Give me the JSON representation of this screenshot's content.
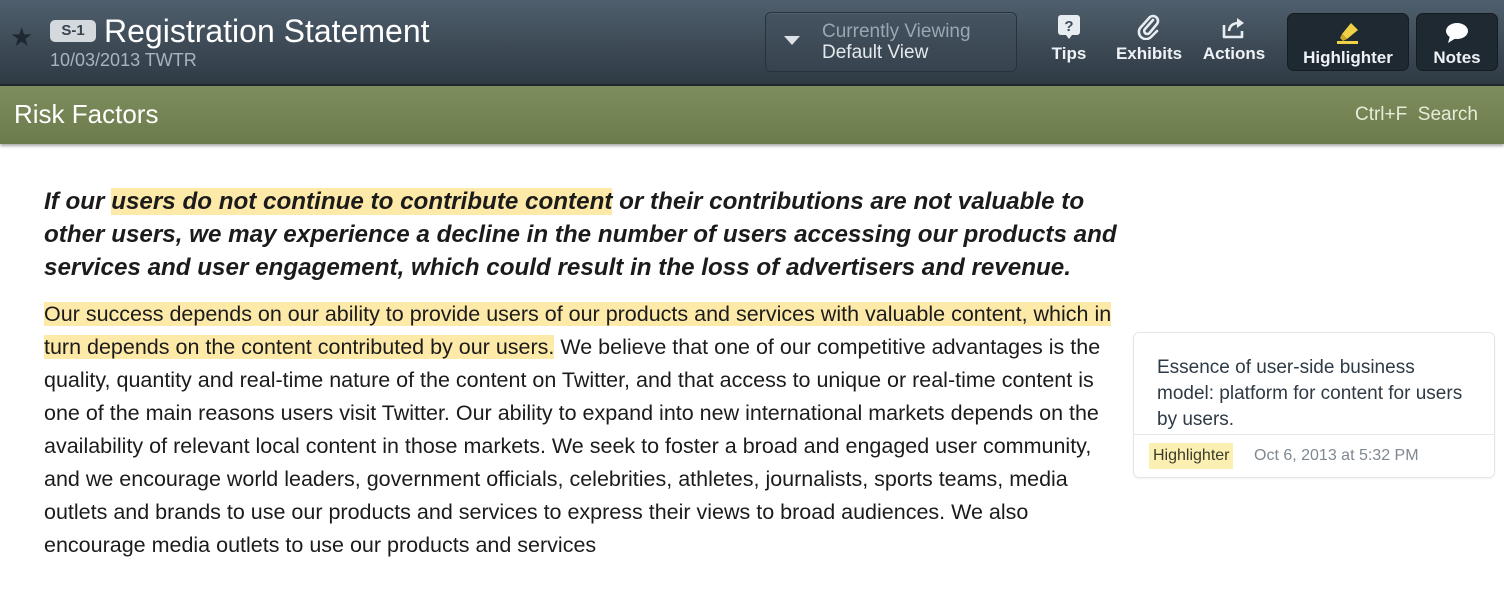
{
  "header": {
    "badge": "S-1",
    "title": "Registration Statement",
    "subtitle": "10/03/2013 TWTR",
    "viewing": {
      "label": "Currently Viewing",
      "value": "Default View"
    },
    "tools": [
      {
        "label": "Tips",
        "icon": "question-icon"
      },
      {
        "label": "Exhibits",
        "icon": "paperclip-icon"
      },
      {
        "label": "Actions",
        "icon": "share-icon"
      },
      {
        "label": "Highlighter",
        "icon": "highlighter-icon"
      },
      {
        "label": "Notes",
        "icon": "speech-bubble-icon"
      }
    ]
  },
  "section": {
    "title": "Risk Factors",
    "search": "Ctrl+F  Search"
  },
  "document": {
    "heading_pre": "If our ",
    "heading_hl": "users do not continue to contribute content",
    "heading_post": " or their contributions are not valuable to other users, we may experience a decline in the number of users accessing our products and services and user engagement, which could result in the loss of advertisers and revenue.",
    "para_hl": "Our success depends on our ability to provide users of our products and services with valuable content, which in turn depends on the content contributed by our users.",
    "para_rest": " We believe that one of our competitive advantages is the quality, quantity and real-time nature of the content on Twitter, and that access to unique or real-time content is one of the main reasons users visit Twitter. Our ability to expand into new international markets depends on the availability of relevant local content in those markets. We seek to foster a broad and engaged user community, and we encourage world leaders, government officials, celebrities, athletes, journalists, sports teams, media outlets and brands to use our products and services to express their views to broad audiences. We also encourage media outlets to use our products and services"
  },
  "note": {
    "text": "Essence of user-side business model: platform for content for users by users.",
    "tag": "Highlighter",
    "date": "Oct 6, 2013 at 5:32 PM"
  },
  "colors": {
    "header_bg": "#3d4a56",
    "section_bg": "#6b7b4c",
    "highlight": "#fde9a8"
  }
}
